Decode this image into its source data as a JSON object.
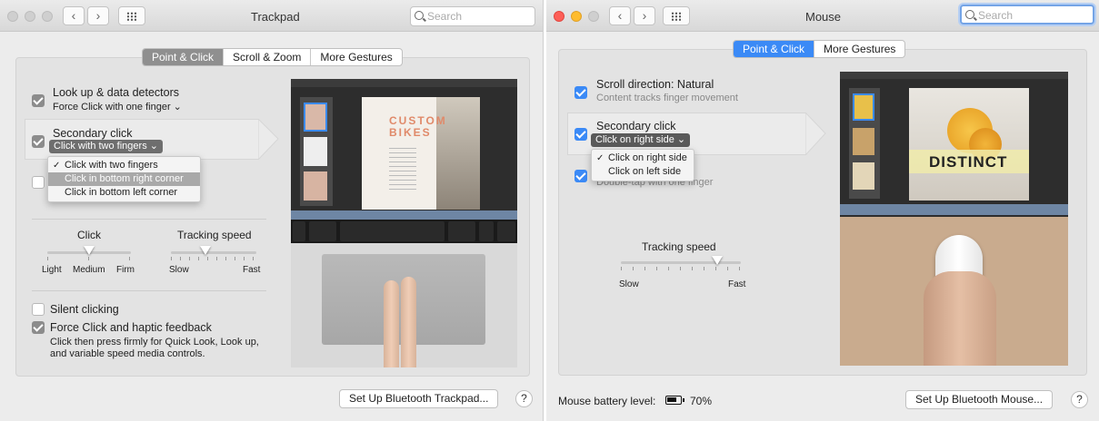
{
  "trackpad": {
    "title": "Trackpad",
    "search_placeholder": "Search",
    "tabs": [
      {
        "label": "Point & Click",
        "selected": true
      },
      {
        "label": "Scroll & Zoom",
        "selected": false
      },
      {
        "label": "More Gestures",
        "selected": false
      }
    ],
    "lookup": {
      "label": "Look up & data detectors",
      "option": "Force Click with one finger",
      "checked": true
    },
    "secondary": {
      "label": "Secondary click",
      "option": "Click with two fingers",
      "checked": true
    },
    "secondary_menu": [
      "Click with two fingers",
      "Click in bottom right corner",
      "Click in bottom left corner"
    ],
    "click_slider": {
      "title": "Click",
      "labels": [
        "Light",
        "Medium",
        "Firm"
      ],
      "value": 0.5
    },
    "tracking_slider": {
      "title": "Tracking speed",
      "labels": [
        "Slow",
        "Fast"
      ],
      "value": 0.4
    },
    "silent": {
      "label": "Silent clicking",
      "checked": false
    },
    "force": {
      "label": "Force Click and haptic feedback",
      "checked": true,
      "desc1": "Click then press firmly for Quick Look, Look up,",
      "desc2": "and variable speed media controls."
    },
    "preview_text": "CUSTOM BIKES",
    "bluetooth_button": "Set Up Bluetooth Trackpad...",
    "help": "?"
  },
  "mouse": {
    "title": "Mouse",
    "search_placeholder": "Search",
    "tabs": [
      {
        "label": "Point & Click",
        "selected": true
      },
      {
        "label": "More Gestures",
        "selected": false
      }
    ],
    "scroll": {
      "label": "Scroll direction: Natural",
      "desc": "Content tracks finger movement",
      "checked": true
    },
    "secondary": {
      "label": "Secondary click",
      "option": "Click on right side",
      "checked": true
    },
    "secondary_menu": [
      "Click on right side",
      "Click on left side"
    ],
    "smart_zoom": {
      "desc": "Double-tap with one finger",
      "checked": true
    },
    "tracking_slider": {
      "title": "Tracking speed",
      "labels": [
        "Slow",
        "Fast"
      ],
      "value": 0.8
    },
    "preview_text": "DISTINCT",
    "battery_label": "Mouse battery level:",
    "battery_value": "70%",
    "bluetooth_button": "Set Up Bluetooth Mouse...",
    "help": "?"
  },
  "colors": {
    "accent": "#3b8af6",
    "selected_gray": "#8f8f8f"
  }
}
